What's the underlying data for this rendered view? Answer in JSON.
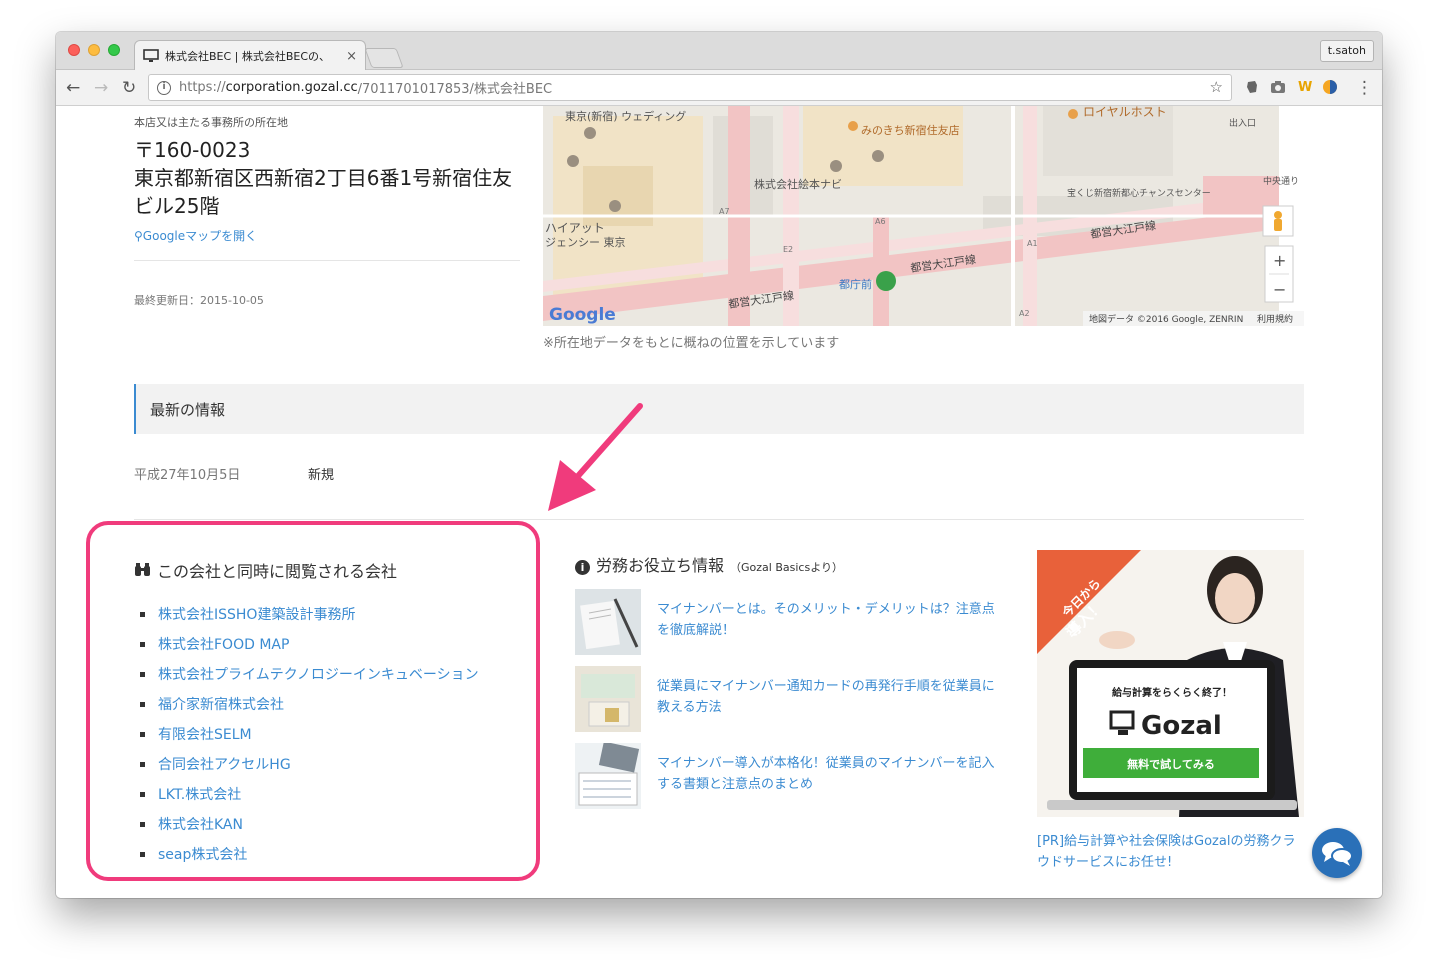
{
  "browser": {
    "tab_title": "株式会社BEC | 株式会社BECの、",
    "tab_close": "×",
    "profile": "t.satoh",
    "url_scheme": "https://",
    "url_host": "corporation.gozal.cc",
    "url_path": "/7011701017853/株式会社BEC",
    "back_icon": "←",
    "forward_icon": "→",
    "reload_icon": "↻",
    "star_icon": "☆",
    "menu_icon": "⋮"
  },
  "address": {
    "label": "本店又は主たる事務所の所在地",
    "postal": "〒160-0023",
    "line": "東京都新宿区西新宿2丁目6番1号新宿住友ビル25階",
    "map_link": "Googleマップを開く",
    "updated": "最終更新日：2015-10-05"
  },
  "map": {
    "labels": {
      "wedding": "東京(新宿) ウェディング",
      "michikita": "みのきち新宿住友店",
      "royal": "ロイヤルホスト",
      "exit": "出入口",
      "ehon": "株式会社絵本ナビ",
      "takarakuji": "宝くじ新宿新都心チャンスセンター",
      "chuo": "中央通り",
      "hyatt1": "ハイアット",
      "hyatt2": "ジェンシー 東京",
      "oedo1": "都営大江戸線",
      "oedo2": "都営大江戸線",
      "oedo3": "都営大江戸線",
      "tochomae": "都庁前",
      "a7": "A7",
      "a6": "A6",
      "e2": "E2",
      "a1": "A1",
      "a2": "A2",
      "zoom_in": "+",
      "zoom_out": "−",
      "google": "Google",
      "copyright": "地図データ ©2016 Google, ZENRIN",
      "terms": "利用規約"
    },
    "note": "※所在地データをもとに概ねの位置を示しています"
  },
  "news": {
    "title": "最新の情報",
    "items": [
      {
        "date": "平成27年10月5日",
        "kind": "新規"
      }
    ]
  },
  "related": {
    "title": "この会社と同時に閲覧される会社",
    "companies": [
      "株式会社ISSHO建築設計事務所",
      "株式会社FOOD MAP",
      "株式会社プライムテクノロジーインキュベーション",
      "福介家新宿株式会社",
      "有限会社SELM",
      "合同会社アクセルHG",
      "LKT.株式会社",
      "株式会社KAN",
      "seap株式会社"
    ]
  },
  "hr_info": {
    "title": "労務お役立ち情報",
    "subtitle": "（Gozal Basicsより）",
    "articles": [
      "マイナンバーとは。そのメリット・デメリットは？注意点を徹底解説！",
      "従業員にマイナンバー通知カードの再発行手順を従業員に教える方法",
      "マイナンバー導入が本格化！従業員のマイナンバーを記入する書類と注意点のまとめ"
    ]
  },
  "ad": {
    "ribbon_line1": "今日から",
    "ribbon_line2": "導入！",
    "headline": "給与計算をらくらく終了！",
    "brand": "Gozal",
    "cta": "無料で試してみる",
    "caption": "[PR]給与計算や社会保険はGozalの労務クラウドサービスにお任せ!"
  },
  "colors": {
    "link": "#3b8bd1",
    "highlight": "#f03b7c",
    "cta_green": "#3fae3a",
    "ribbon": "#e8613a",
    "chat": "#2a70b8"
  }
}
